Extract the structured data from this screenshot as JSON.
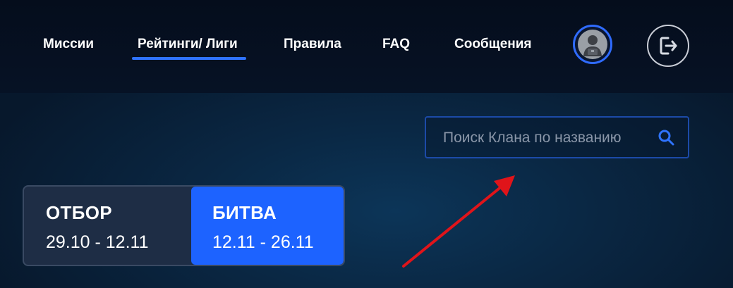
{
  "nav": {
    "items": [
      {
        "label": "Миссии"
      },
      {
        "label": "Рейтинги/ Лиги",
        "active": true
      },
      {
        "label": "Правила"
      },
      {
        "label": "FAQ"
      },
      {
        "label": "Сообщения"
      }
    ]
  },
  "header": {
    "avatar_icon": "user-avatar-icon",
    "logout_icon": "logout-icon"
  },
  "search": {
    "placeholder": "Поиск Клана по названию",
    "value": "",
    "icon": "search-icon"
  },
  "stages": [
    {
      "title": "ОТБОР",
      "dates": "29.10 - 12.11",
      "selected": false
    },
    {
      "title": "БИТВА",
      "dates": "12.11 - 26.11",
      "selected": true
    }
  ],
  "colors": {
    "accent": "#1d63ff",
    "header_bg": "#050d1c",
    "page_bg": "#0a2743",
    "annotation_arrow": "#e0141a"
  }
}
